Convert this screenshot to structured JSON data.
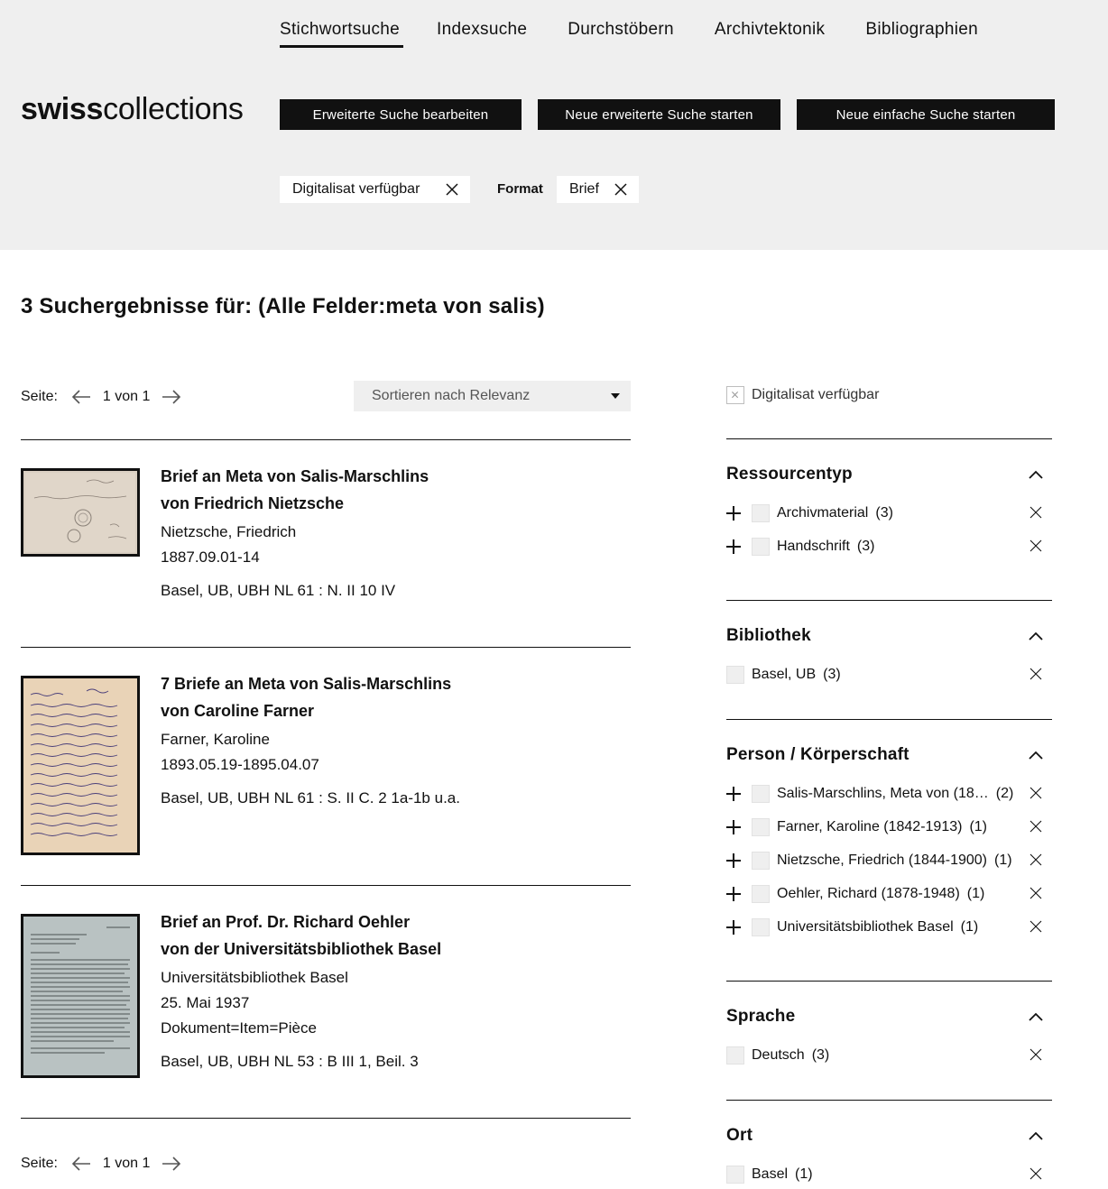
{
  "nav": {
    "items": [
      {
        "label": "Stichwortsuche",
        "active": true
      },
      {
        "label": "Indexsuche",
        "active": false
      },
      {
        "label": "Durchstöbern",
        "active": false
      },
      {
        "label": "Archivtektonik",
        "active": false
      },
      {
        "label": "Bibliographien",
        "active": false
      }
    ]
  },
  "logo": {
    "bold": "swiss",
    "light": "collections"
  },
  "actions": {
    "edit_advanced": "Erweiterte Suche bearbeiten",
    "new_advanced": "Neue erweiterte Suche starten",
    "new_simple": "Neue einfache Suche starten"
  },
  "active_filters": {
    "digitized": "Digitalisat verfügbar",
    "format_label": "Format",
    "format_value": "Brief"
  },
  "results": {
    "heading": "3 Suchergebnisse für: (Alle Felder:meta von salis)",
    "pager": {
      "label": "Seite:",
      "page_text": "1 von 1"
    },
    "sort": {
      "selected": "Sortieren nach Relevanz"
    },
    "items": [
      {
        "title1": "Brief an Meta von Salis-Marschlins",
        "title2": "von Friedrich Nietzsche",
        "lines": [
          "Nietzsche, Friedrich",
          "1887.09.01-14"
        ],
        "signature": "Basel, UB, UBH NL 61 : N. II 10 IV"
      },
      {
        "title1": "7 Briefe an Meta von Salis-Marschlins",
        "title2": "von Caroline Farner",
        "lines": [
          "Farner, Karoline",
          "1893.05.19-1895.04.07"
        ],
        "signature": "Basel, UB, UBH NL 61 : S. II C. 2 1a-1b u.a."
      },
      {
        "title1": "Brief an Prof. Dr. Richard Oehler",
        "title2": "von der Universitätsbibliothek Basel",
        "lines": [
          "Universitätsbibliothek Basel",
          "25. Mai 1937",
          "Dokument=Item=Pièce"
        ],
        "signature": "Basel, UB, UBH NL 53 : B III 1, Beil. 3"
      }
    ]
  },
  "facets": {
    "digitized": "Digitalisat verfügbar",
    "groups": [
      {
        "title": "Ressourcentyp",
        "options": [
          {
            "label": "Archivmaterial",
            "count": "(3)"
          },
          {
            "label": "Handschrift",
            "count": "(3)"
          }
        ]
      },
      {
        "title": "Bibliothek",
        "options": [
          {
            "label": "Basel, UB",
            "count": "(3)"
          }
        ]
      },
      {
        "title": "Person / Körperschaft",
        "options": [
          {
            "label": "Salis-Marschlins, Meta von (18…",
            "count": "(2)"
          },
          {
            "label": "Farner, Karoline (1842-1913)",
            "count": "(1)"
          },
          {
            "label": "Nietzsche, Friedrich (1844-1900)",
            "count": "(1)"
          },
          {
            "label": "Oehler, Richard (1878-1948)",
            "count": "(1)"
          },
          {
            "label": "Universitätsbibliothek Basel",
            "count": "(1)"
          }
        ]
      },
      {
        "title": "Sprache",
        "options": [
          {
            "label": "Deutsch",
            "count": "(3)"
          }
        ]
      },
      {
        "title": "Ort",
        "options": [
          {
            "label": "Basel",
            "count": "(1)"
          }
        ]
      }
    ]
  }
}
